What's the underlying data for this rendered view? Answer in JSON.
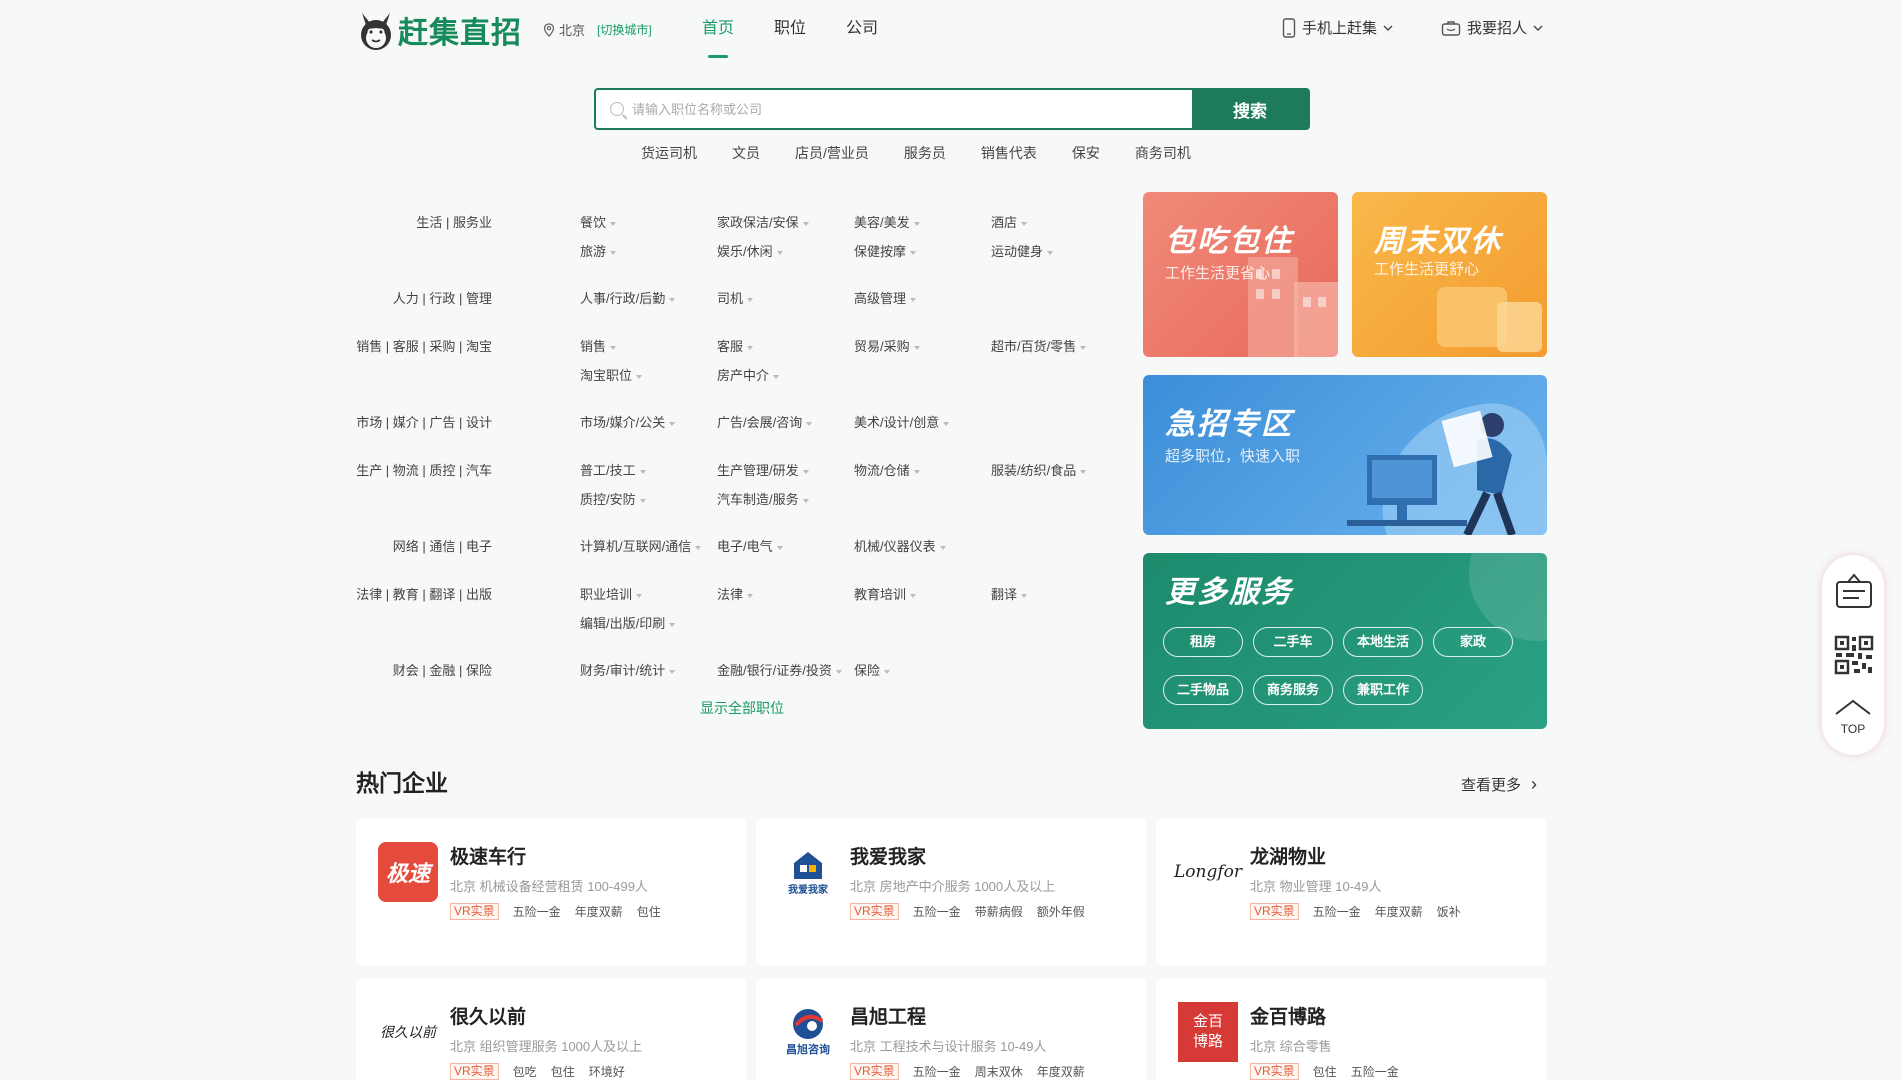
{
  "header": {
    "logo_text": "赶集直招",
    "city": "北京",
    "switch_city": "[切换城市]",
    "nav": [
      {
        "label": "首页",
        "active": true
      },
      {
        "label": "职位",
        "active": false
      },
      {
        "label": "公司",
        "active": false
      }
    ],
    "mobile": "手机上赶集",
    "recruit": "我要招人"
  },
  "search": {
    "placeholder": "请输入职位名称或公司",
    "button": "搜索",
    "hot_keys": [
      "货运司机",
      "文员",
      "店员/营业员",
      "服务员",
      "销售代表",
      "保安",
      "商务司机"
    ]
  },
  "categories": [
    {
      "title": "生活 | 服务业",
      "items": [
        "餐饮",
        "家政保洁/安保",
        "美容/美发",
        "酒店",
        "旅游",
        "娱乐/休闲",
        "保健按摩",
        "运动健身"
      ]
    },
    {
      "title": "人力 | 行政 | 管理",
      "items": [
        "人事/行政/后勤",
        "司机",
        "高级管理"
      ]
    },
    {
      "title": "销售 | 客服 | 采购 | 淘宝",
      "items": [
        "销售",
        "客服",
        "贸易/采购",
        "超市/百货/零售",
        "淘宝职位",
        "房产中介"
      ]
    },
    {
      "title": "市场 | 媒介 | 广告 | 设计",
      "items": [
        "市场/媒介/公关",
        "广告/会展/咨询",
        "美术/设计/创意"
      ]
    },
    {
      "title": "生产 | 物流 | 质控 | 汽车",
      "items": [
        "普工/技工",
        "生产管理/研发",
        "物流/仓储",
        "服装/纺织/食品",
        "质控/安防",
        "汽车制造/服务"
      ]
    },
    {
      "title": "网络 | 通信 | 电子",
      "items": [
        "计算机/互联网/通信",
        "电子/电气",
        "机械/仪器仪表"
      ]
    },
    {
      "title": "法律 | 教育 | 翻译 | 出版",
      "items": [
        "职业培训",
        "法律",
        "教育培训",
        "翻译",
        "编辑/出版/印刷"
      ]
    },
    {
      "title": "财会 | 金融 | 保险",
      "items": [
        "财务/审计/统计",
        "金融/银行/证券/投资",
        "保险"
      ]
    }
  ],
  "show_all": "显示全部职位",
  "banners": {
    "food": {
      "title": "包吃包住",
      "sub": "工作生活更省心"
    },
    "weekend": {
      "title": "周末双休",
      "sub": "工作生活更舒心"
    },
    "urgent": {
      "title": "急招专区",
      "sub": "超多职位，快速入职"
    },
    "more": {
      "title": "更多服务",
      "buttons": [
        "租房",
        "二手车",
        "本地生活",
        "家政",
        "二手物品",
        "商务服务",
        "兼职工作"
      ]
    }
  },
  "side": {
    "top": "TOP"
  },
  "hot": {
    "title": "热门企业",
    "more": "查看更多",
    "vr_label": "VR实景",
    "companies": [
      {
        "name": "极速车行",
        "meta": "北京   机械设备经营租赁   100-499人",
        "tags": [
          "五险一金",
          "年度双薪",
          "包住"
        ],
        "logo_text": "极速"
      },
      {
        "name": "我爱我家",
        "meta": "北京   房地产中介服务   1000人及以上",
        "tags": [
          "五险一金",
          "带薪病假",
          "额外年假"
        ],
        "logo_text": "我爱我家"
      },
      {
        "name": "龙湖物业",
        "meta": "北京   物业管理   10-49人",
        "tags": [
          "五险一金",
          "年度双薪",
          "饭补"
        ],
        "logo_text": "Longfor"
      },
      {
        "name": "很久以前",
        "meta": "北京   组织管理服务   1000人及以上",
        "tags": [
          "包吃",
          "包住",
          "环境好"
        ],
        "logo_text": "很久以前"
      },
      {
        "name": "昌旭工程",
        "meta": "北京   工程技术与设计服务   10-49人",
        "tags": [
          "五险一金",
          "周末双休",
          "年度双薪"
        ],
        "logo_text": "昌旭咨询"
      },
      {
        "name": "金百博路",
        "meta": "北京   综合零售",
        "tags": [
          "包住",
          "五险一金"
        ],
        "logo_text": "金百博路"
      }
    ]
  },
  "colors": {
    "brand": "#1a9b66",
    "search_border": "#1d7a5a",
    "vr": "#e85b36"
  }
}
